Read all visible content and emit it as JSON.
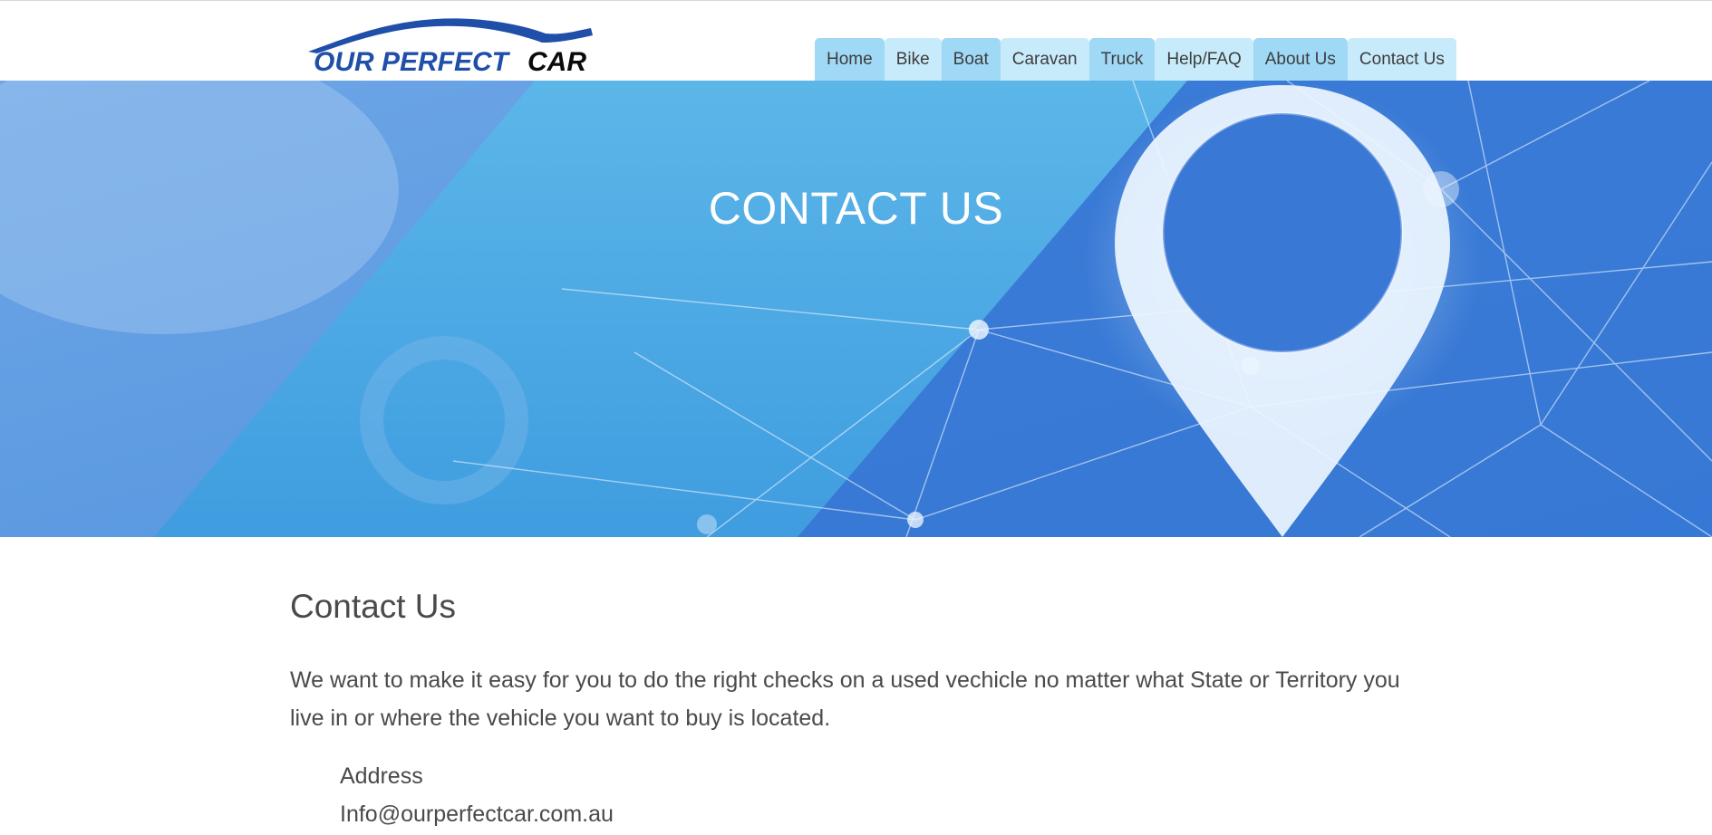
{
  "brand": {
    "logo_text_part1": "OUR PERFECT",
    "logo_text_part2": "CAR",
    "logo_color_blue": "#1f4fa8",
    "logo_color_black": "#0b0b0b"
  },
  "nav": {
    "items": [
      {
        "label": "Home"
      },
      {
        "label": "Bike"
      },
      {
        "label": "Boat"
      },
      {
        "label": "Caravan"
      },
      {
        "label": "Truck"
      },
      {
        "label": "Help/FAQ"
      },
      {
        "label": "About Us"
      },
      {
        "label": "Contact Us"
      }
    ],
    "tab_colors": [
      "#9fd9f6",
      "#c8ebfb"
    ]
  },
  "hero": {
    "title": "CONTACT US",
    "icon": "location-pin-icon",
    "colors": {
      "light_blue": "#56b2e6",
      "mid_blue": "#3a84d8",
      "dark_blue": "#2b67c9"
    }
  },
  "main": {
    "heading": "Contact Us",
    "intro": "We want to make it easy for you to do the right checks on a used vechicle no matter what State or Territory you live in or where the vehicle you want to buy is located.",
    "address_label": "Address",
    "email": "Info@ourperfectcar.com.au"
  }
}
